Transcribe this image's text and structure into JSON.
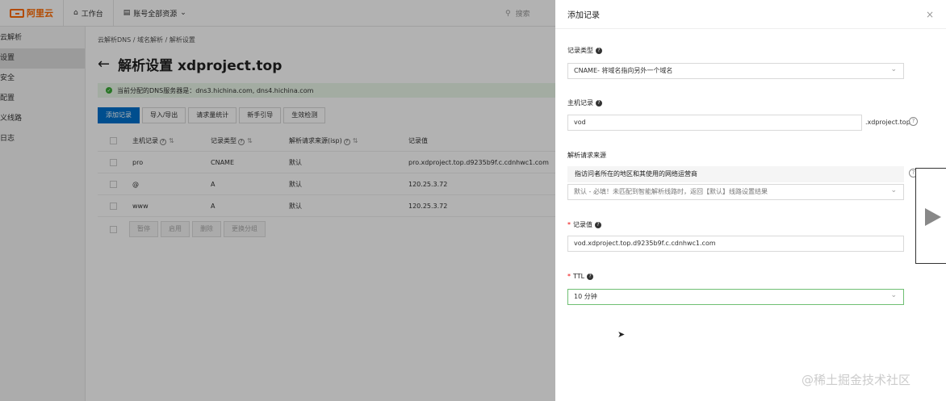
{
  "topbar": {
    "logo_text": "阿里云",
    "workbench": "工作台",
    "account_menu": "账号全部资源",
    "search_placeholder": "搜索"
  },
  "sidebar": {
    "items": [
      {
        "label": "云解析"
      },
      {
        "label": "设置"
      },
      {
        "label": "安全"
      },
      {
        "label": "配置"
      },
      {
        "label": "义线路"
      },
      {
        "label": "日志"
      }
    ],
    "active_index": 1
  },
  "main": {
    "breadcrumb": [
      "云解析DNS",
      "/",
      "域名解析",
      "/",
      "解析设置"
    ],
    "title": "解析设置 xdproject.top",
    "dns_info": "当前分配的DNS服务器是：dns3.hichina.com, dns4.hichina.com",
    "toolbar": [
      "添加记录",
      "导入/导出",
      "请求量统计",
      "新手引导",
      "生效检测"
    ],
    "table": {
      "columns": [
        "主机记录",
        "记录类型",
        "解析请求来源(isp)",
        "记录值"
      ],
      "rows": [
        {
          "host": "pro",
          "type": "CNAME",
          "source": "默认",
          "value": "pro.xdproject.top.d9235b9f.c.cdnhwc1.com"
        },
        {
          "host": "@",
          "type": "A",
          "source": "默认",
          "value": "120.25.3.72"
        },
        {
          "host": "www",
          "type": "A",
          "source": "默认",
          "value": "120.25.3.72"
        }
      ]
    },
    "bulk_actions": [
      "暂停",
      "启用",
      "删除",
      "更换分组"
    ]
  },
  "drawer": {
    "title": "添加记录",
    "record_type_label": "记录类型",
    "record_type_value": "CNAME- 将域名指向另外一个域名",
    "host_label": "主机记录",
    "host_value": "vod",
    "host_suffix": ".xdproject.top",
    "source_label": "解析请求来源",
    "source_tip": "指访问者所在的地区和其使用的网络运营商",
    "source_value": "默认 - 必填！未匹配到智能解析线路时，返回【默认】线路设置结果",
    "value_label": "记录值",
    "value_value": "vod.xdproject.top.d9235b9f.c.cdnhwc1.com",
    "ttl_label": "TTL",
    "ttl_value": "10 分钟"
  },
  "watermark": "@稀土掘金技术社区"
}
